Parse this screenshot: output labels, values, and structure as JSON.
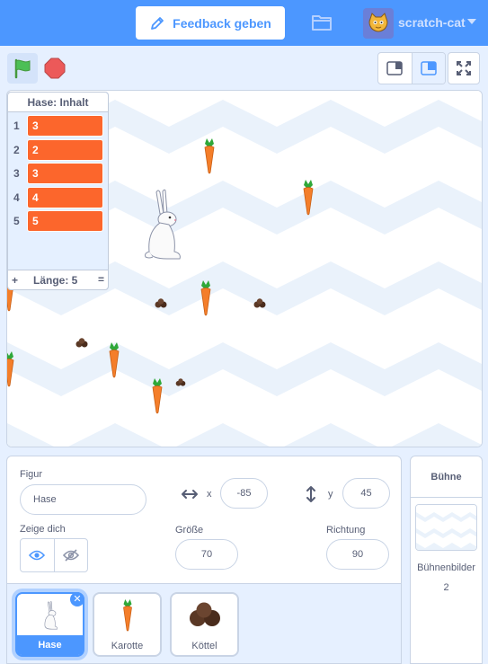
{
  "menu": {
    "feedback_label": "Feedback geben",
    "username": "scratch-cat"
  },
  "list_monitor": {
    "title": "Hase: Inhalt",
    "items": [
      {
        "index": "1",
        "value": "3"
      },
      {
        "index": "2",
        "value": "2"
      },
      {
        "index": "3",
        "value": "3"
      },
      {
        "index": "4",
        "value": "4"
      },
      {
        "index": "5",
        "value": "5"
      }
    ],
    "add_symbol": "+",
    "length_label": "Länge: 5",
    "resize_symbol": "="
  },
  "sprite_info": {
    "sprite_label": "Figur",
    "sprite_name": "Hase",
    "x_label": "x",
    "x_value": "-85",
    "y_label": "y",
    "y_value": "45",
    "show_label": "Zeige dich",
    "size_label": "Größe",
    "size_value": "70",
    "direction_label": "Richtung",
    "direction_value": "90"
  },
  "sprites": [
    {
      "name": "Hase",
      "icon": "rabbit-icon",
      "selected": true
    },
    {
      "name": "Karotte",
      "icon": "carrot-icon",
      "selected": false
    },
    {
      "name": "Köttel",
      "icon": "droppings-icon",
      "selected": false
    }
  ],
  "stage_pane": {
    "title": "Bühne",
    "backdrops_label": "Bühnenbilder",
    "backdrops_count": "2"
  },
  "colors": {
    "menu_bar": "#4c97ff",
    "accent": "#4c97ff",
    "list_item": "#fc662c",
    "green_flag": "#4cbf56",
    "stop": "#ec5959",
    "carrot": "#f47e2a",
    "carrot_leaves": "#2fa839",
    "droppings": "#5a3825"
  }
}
